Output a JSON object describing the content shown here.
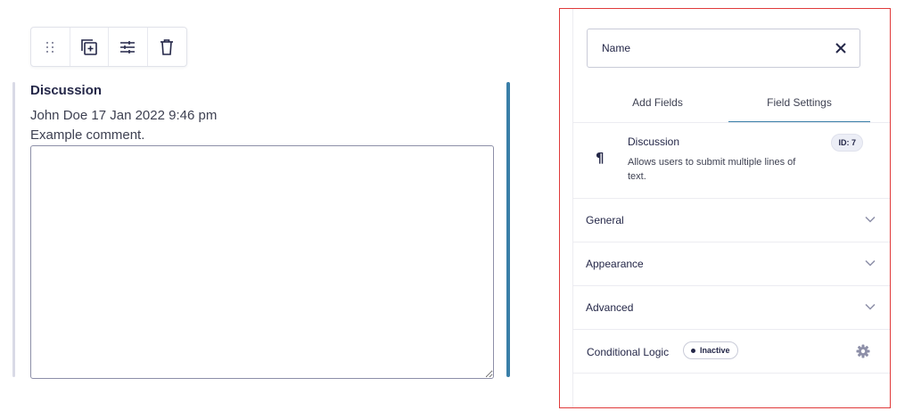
{
  "toolbar": {
    "buttons": [
      {
        "icon": "drag-handle-icon"
      },
      {
        "icon": "duplicate-icon"
      },
      {
        "icon": "settings-sliders-icon"
      },
      {
        "icon": "trash-icon"
      }
    ]
  },
  "field": {
    "label": "Discussion",
    "meta": "John Doe 17 Jan 2022 9:46 pm",
    "comment": "Example comment.",
    "textarea_value": ""
  },
  "panel": {
    "name_value": "Name",
    "tabs": [
      {
        "label": "Add Fields",
        "active": false
      },
      {
        "label": "Field Settings",
        "active": true
      }
    ],
    "field_info": {
      "icon": "¶",
      "title": "Discussion",
      "description": "Allows users to submit multiple lines of text.",
      "id_badge": "ID: 7"
    },
    "sections": [
      {
        "label": "General"
      },
      {
        "label": "Appearance"
      },
      {
        "label": "Advanced"
      }
    ],
    "conditional_logic": {
      "label": "Conditional Logic",
      "status": "Inactive"
    }
  },
  "colors": {
    "accent": "#3a7fa8",
    "panel_border": "#e03a3a",
    "text": "#242748"
  }
}
